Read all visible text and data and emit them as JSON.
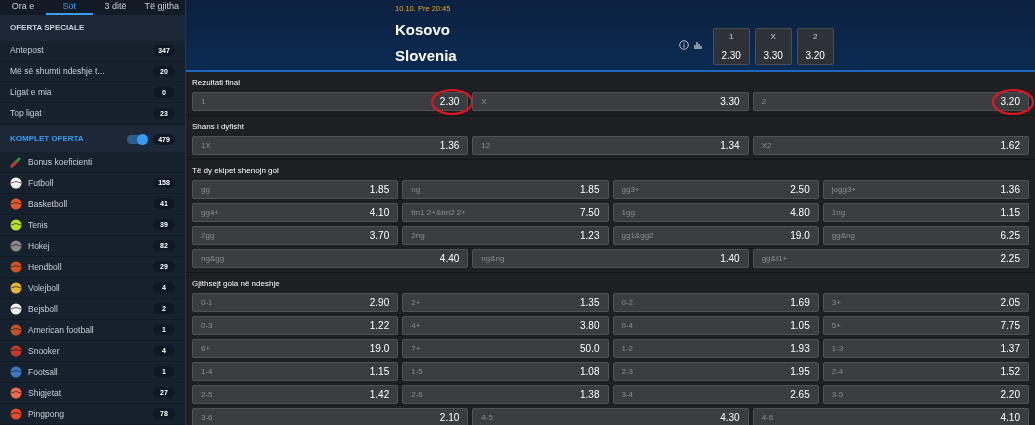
{
  "tabs": [
    {
      "label": "Ora e",
      "selected": false
    },
    {
      "label": "Sot",
      "selected": true
    },
    {
      "label": "3 ditë",
      "selected": false
    },
    {
      "label": "Të gjitha",
      "selected": false
    }
  ],
  "special": {
    "title": "OFERTA SPECIALE",
    "items": [
      {
        "label": "Antepost",
        "count": "347"
      },
      {
        "label": "Më së shumti ndeshje t...",
        "count": "20"
      },
      {
        "label": "Ligat e mia",
        "count": "0"
      },
      {
        "label": "Top ligat",
        "count": "23"
      }
    ]
  },
  "komplet": {
    "title": "KOMPLET OFERTA",
    "on": true,
    "count": "479"
  },
  "sports": [
    {
      "name": "Bonus koeficienti"
    },
    {
      "name": "Futboll",
      "count": "158"
    },
    {
      "name": "Basketboll",
      "count": "41"
    },
    {
      "name": "Tenis",
      "count": "39"
    },
    {
      "name": "Hokej",
      "count": "82"
    },
    {
      "name": "Hendboll",
      "count": "29"
    },
    {
      "name": "Volejboll",
      "count": "4"
    },
    {
      "name": "Bejsboll",
      "count": "2"
    },
    {
      "name": "American football",
      "count": "1"
    },
    {
      "name": "Snooker",
      "count": "4"
    },
    {
      "name": "Footsall",
      "count": "1"
    },
    {
      "name": "Shigjetat",
      "count": "27"
    },
    {
      "name": "Pingpong",
      "count": "78"
    }
  ],
  "match": {
    "date": "10.10. Pre 20:45",
    "home": "Kosovo",
    "away": "Slovenia",
    "odds": [
      {
        "label": "1",
        "value": "2.30"
      },
      {
        "label": "X",
        "value": "3.30"
      },
      {
        "label": "2",
        "value": "3.20"
      }
    ]
  },
  "markets": [
    {
      "title": "Rezultati final",
      "rows": [
        [
          {
            "label": "1",
            "value": "2.30",
            "circled": true
          },
          {
            "label": "X",
            "value": "3.30",
            "circled": false
          },
          {
            "label": "2",
            "value": "3.20",
            "circled": true
          }
        ]
      ]
    },
    {
      "title": "Shans i dyfisht",
      "rows": [
        [
          {
            "label": "1X",
            "value": "1.36"
          },
          {
            "label": "12",
            "value": "1.34"
          },
          {
            "label": "X2",
            "value": "1.62"
          }
        ]
      ]
    },
    {
      "title": "Të dy ekipet shenojn gol",
      "rows": [
        [
          {
            "label": "gg",
            "value": "1.85"
          },
          {
            "label": "ng",
            "value": "1.85"
          },
          {
            "label": "gg3+",
            "value": "2.50"
          },
          {
            "label": "jogg3+",
            "value": "1.36"
          }
        ],
        [
          {
            "label": "gg4+",
            "value": "4.10"
          },
          {
            "label": "tm1 2+&tm2 2+",
            "value": "7.50"
          },
          {
            "label": "1gg",
            "value": "4.80"
          },
          {
            "label": "1ng",
            "value": "1.15"
          }
        ],
        [
          {
            "label": "2gg",
            "value": "3.70"
          },
          {
            "label": "2ng",
            "value": "1.23"
          },
          {
            "label": "gg1&gg2",
            "value": "19.0"
          },
          {
            "label": "gg&ng",
            "value": "6.25"
          }
        ],
        [
          {
            "label": "ng&gg",
            "value": "4.40"
          },
          {
            "label": "ng&ng",
            "value": "1.40"
          },
          {
            "label": "gg&I1+",
            "value": "2.25"
          }
        ]
      ]
    },
    {
      "title": "Gjithsejt gola në ndeshje",
      "rows": [
        [
          {
            "label": "0-1",
            "value": "2.90"
          },
          {
            "label": "2+",
            "value": "1.35"
          },
          {
            "label": "0-2",
            "value": "1.69"
          },
          {
            "label": "3+",
            "value": "2.05"
          }
        ],
        [
          {
            "label": "0-3",
            "value": "1.22"
          },
          {
            "label": "4+",
            "value": "3.80"
          },
          {
            "label": "0-4",
            "value": "1.05"
          },
          {
            "label": "5+",
            "value": "7.75"
          }
        ],
        [
          {
            "label": "6+",
            "value": "19.0"
          },
          {
            "label": "7+",
            "value": "50.0"
          },
          {
            "label": "1-2",
            "value": "1.93"
          },
          {
            "label": "1-3",
            "value": "1.37"
          }
        ],
        [
          {
            "label": "1-4",
            "value": "1.15"
          },
          {
            "label": "1-5",
            "value": "1.08"
          },
          {
            "label": "2-3",
            "value": "1.95"
          },
          {
            "label": "2-4",
            "value": "1.52"
          }
        ],
        [
          {
            "label": "2-5",
            "value": "1.42"
          },
          {
            "label": "2-6",
            "value": "1.38"
          },
          {
            "label": "3-4",
            "value": "2.65"
          },
          {
            "label": "3-5",
            "value": "2.20"
          }
        ],
        [
          {
            "label": "3-6",
            "value": "2.10"
          },
          {
            "label": "4-5",
            "value": "4.30"
          },
          {
            "label": "4-6",
            "value": "4.10"
          }
        ]
      ]
    }
  ]
}
